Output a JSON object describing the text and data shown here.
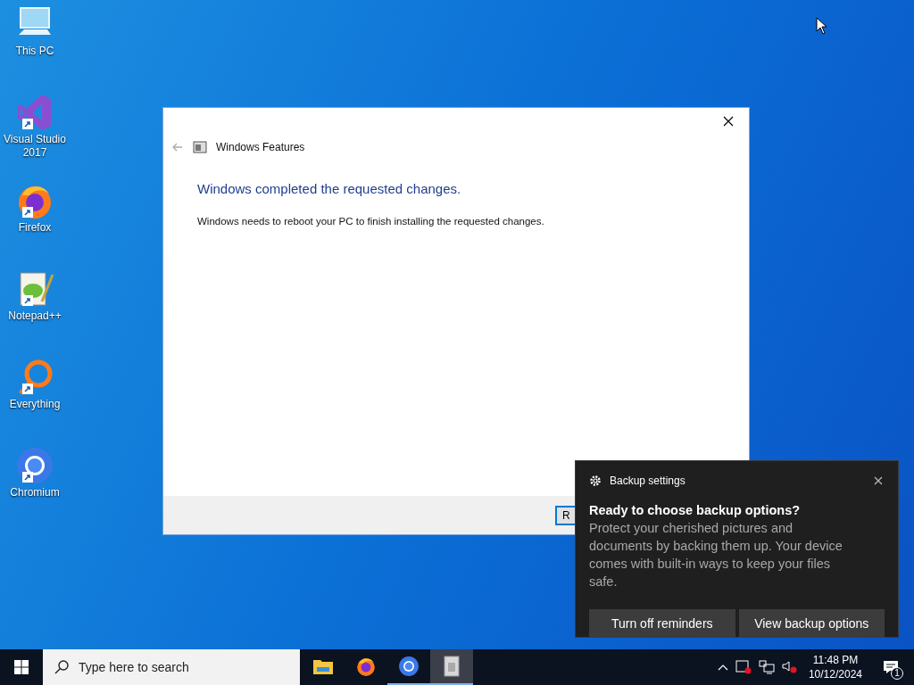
{
  "desktop_icons": [
    {
      "label": "This PC",
      "kind": "pc",
      "shortcut": false
    },
    {
      "label": "Visual Studio 2017",
      "kind": "vs",
      "shortcut": true
    },
    {
      "label": "Firefox",
      "kind": "firefox",
      "shortcut": true
    },
    {
      "label": "Notepad++",
      "kind": "notepad",
      "shortcut": true
    },
    {
      "label": "Everything",
      "kind": "everything",
      "shortcut": true
    },
    {
      "label": "Chromium",
      "kind": "chromium",
      "shortcut": true
    }
  ],
  "dialog": {
    "title": "Windows Features",
    "heading": "Windows completed the requested changes.",
    "message": "Windows needs to reboot your PC to finish installing the requested changes.",
    "button": "R"
  },
  "toast": {
    "app": "Backup settings",
    "title": "Ready to choose backup options?",
    "body": "Protect your cherished pictures and documents by backing them up. Your device comes with built-in ways to keep your files safe.",
    "buttons": [
      "Turn off reminders",
      "View backup options"
    ]
  },
  "taskbar": {
    "search_placeholder": "Type here to search",
    "apps": [
      {
        "kind": "explorer",
        "selected": false
      },
      {
        "kind": "firefox",
        "selected": false
      },
      {
        "kind": "chromium",
        "selected": false
      },
      {
        "kind": "features",
        "selected": true
      }
    ],
    "time": "11:48 PM",
    "date": "10/12/2024",
    "notification_count": "1"
  }
}
